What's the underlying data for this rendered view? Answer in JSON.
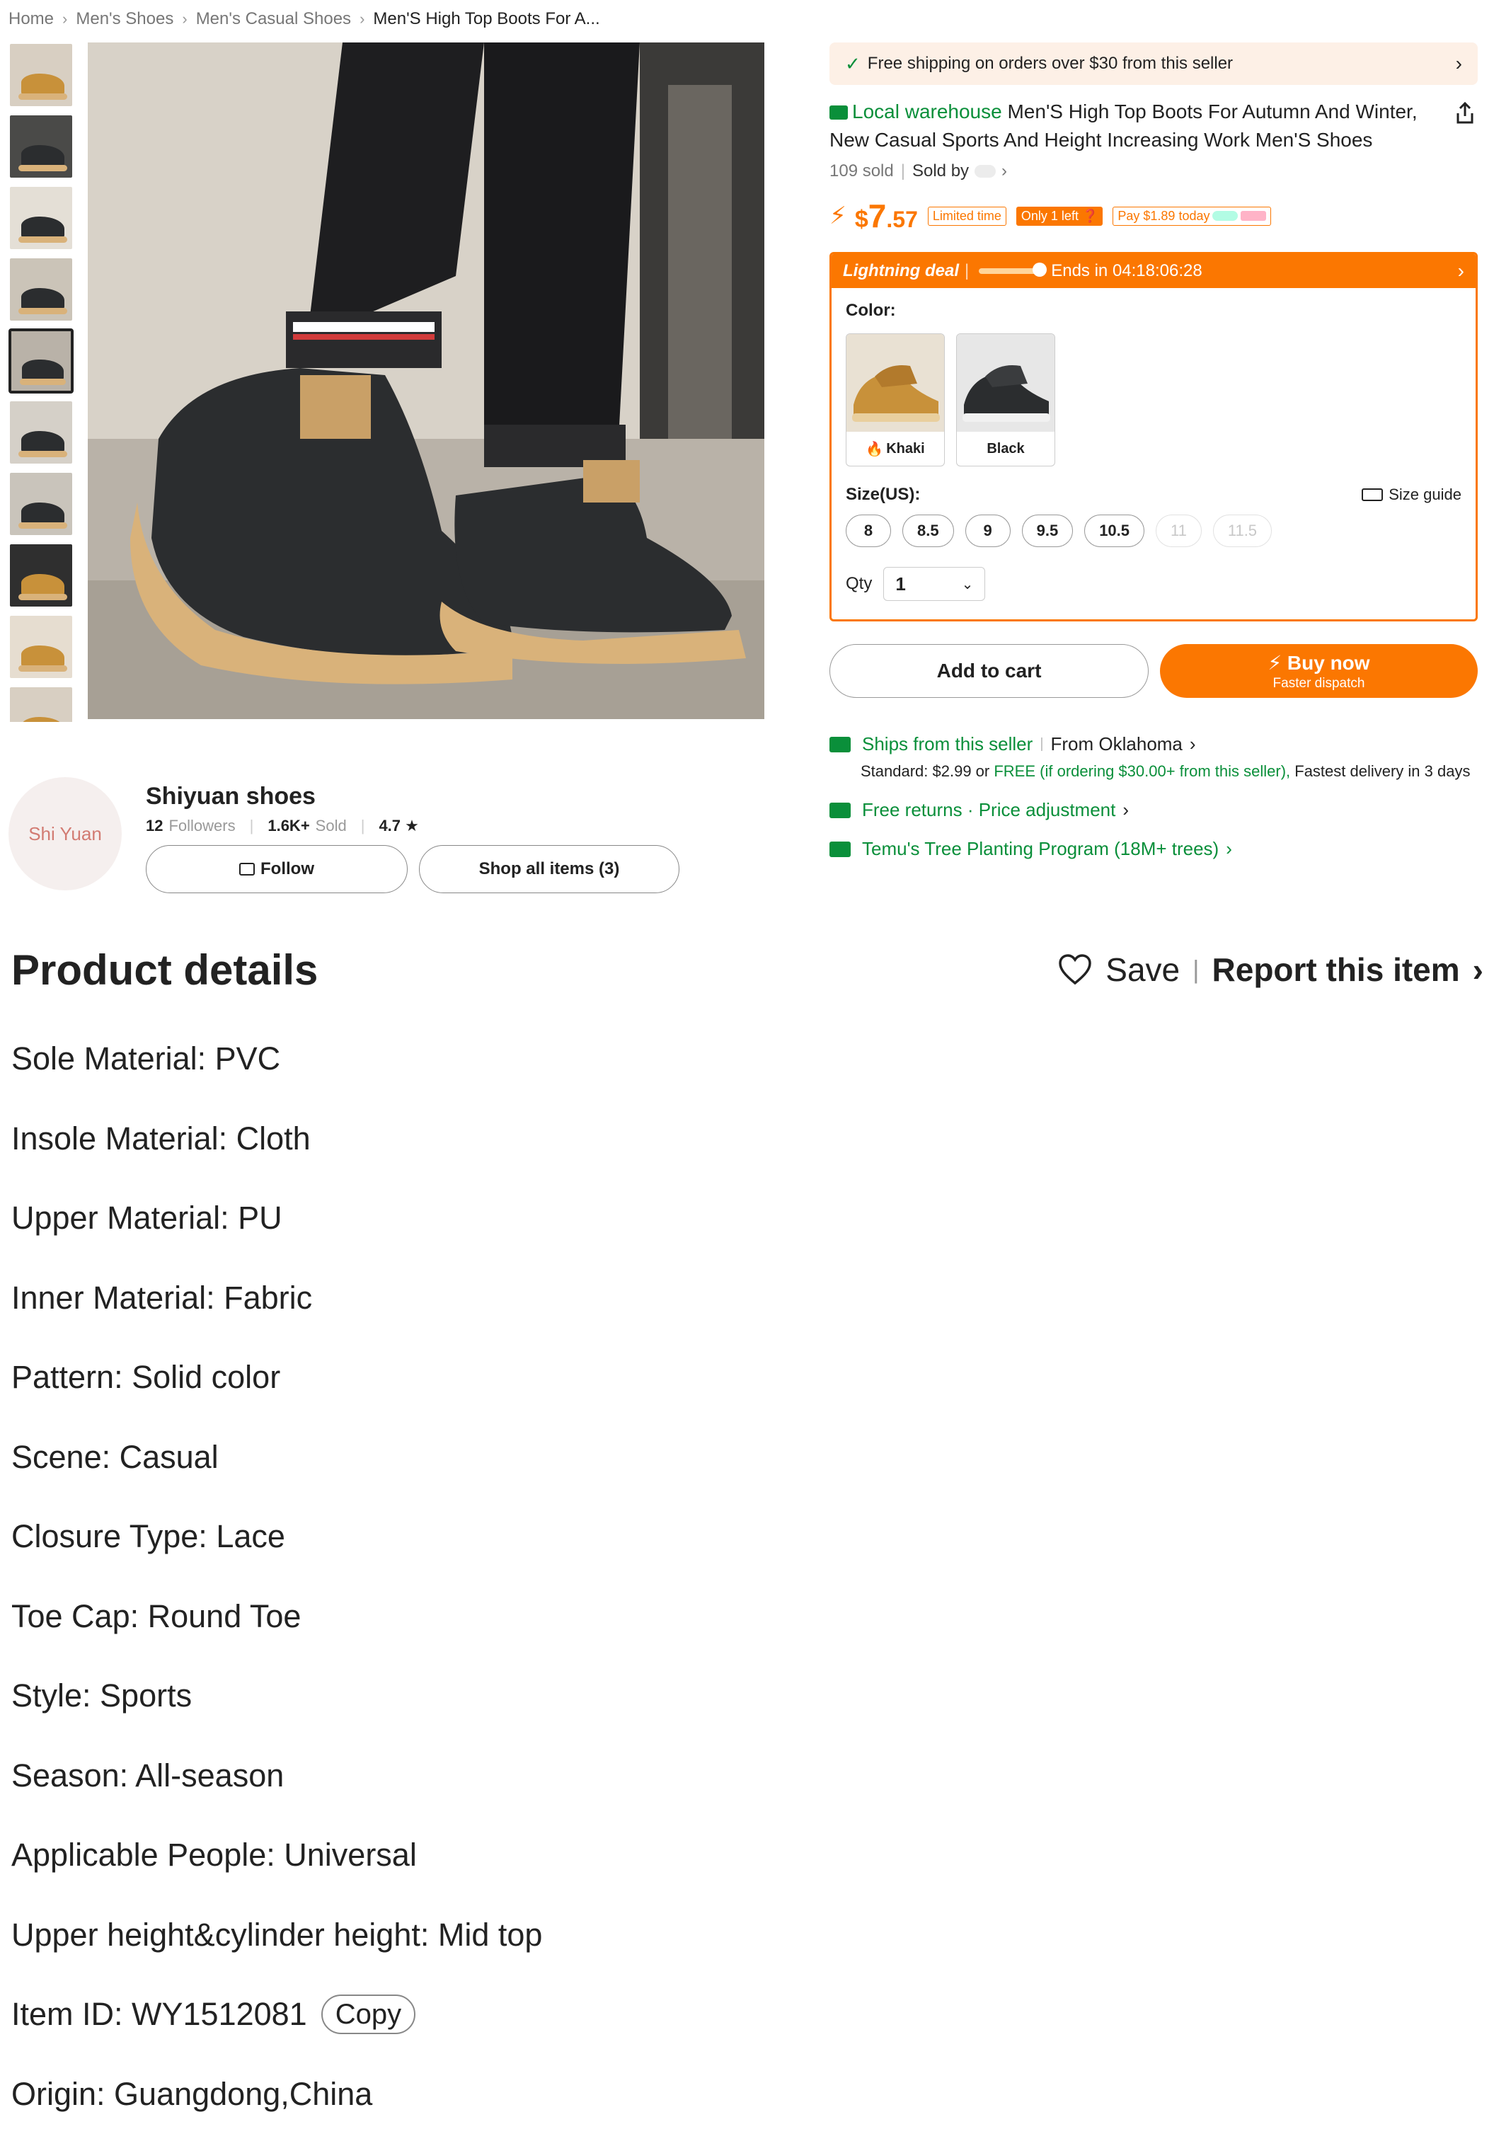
{
  "breadcrumb": [
    "Home",
    "Men's Shoes",
    "Men's Casual Shoes",
    "Men'S High Top Boots For A..."
  ],
  "gallery": {
    "thumbnails": 10,
    "active_index": 4
  },
  "shipping_banner": "Free shipping on orders over $30 from this seller",
  "product": {
    "badge": "Local warehouse",
    "title": "Men'S High Top Boots For Autumn And Winter, New Casual Sports And Height Increasing Work Men'S Shoes",
    "sold": "109 sold",
    "sold_by": "Sold by",
    "price_currency": "$",
    "price_int": "7",
    "price_dec": ".57",
    "tag_limited": "Limited time",
    "tag_left": "Only 1 left",
    "tag_pay": "Pay $1.89 today"
  },
  "deal": {
    "label": "Lightning deal",
    "ends": "Ends in 04:18:06:28"
  },
  "options": {
    "color_label": "Color:",
    "colors": [
      {
        "name": "Khaki",
        "hot": true
      },
      {
        "name": "Black",
        "hot": false
      }
    ],
    "size_label": "Size(US):",
    "size_guide": "Size guide",
    "sizes": [
      {
        "v": "8",
        "available": true
      },
      {
        "v": "8.5",
        "available": true
      },
      {
        "v": "9",
        "available": true
      },
      {
        "v": "9.5",
        "available": true
      },
      {
        "v": "10.5",
        "available": true
      },
      {
        "v": "11",
        "available": false
      },
      {
        "v": "11.5",
        "available": false
      }
    ],
    "qty_label": "Qty",
    "qty_value": "1"
  },
  "actions": {
    "add_to_cart": "Add to cart",
    "buy_now": "Buy now",
    "buy_now_sub": "Faster dispatch"
  },
  "shipping": {
    "ships_from": "Ships from this seller",
    "origin": "From Oklahoma",
    "standard_pre": "Standard: $2.99 or ",
    "standard_free": "FREE (if ordering $30.00+ from this seller),",
    "standard_post": " Fastest delivery in 3 days",
    "returns": "Free returns · Price adjustment",
    "tree": "Temu's Tree Planting Program (18M+ trees)"
  },
  "seller": {
    "avatar": "Shi Yuan",
    "name": "Shiyuan shoes",
    "followers_num": "12",
    "followers_label": "Followers",
    "sold_num": "1.6K+",
    "sold_label": "Sold",
    "rating": "4.7 ★",
    "follow": "Follow",
    "shop_all": "Shop all items (3)"
  },
  "details": {
    "title": "Product details",
    "save": "Save",
    "report": "Report this item",
    "copy": "Copy",
    "attributes": [
      "Sole Material: PVC",
      "Insole Material: Cloth",
      "Upper Material: PU",
      "Inner Material: Fabric",
      "Pattern: Solid color",
      "Scene: Casual",
      "Closure Type: Lace",
      "Toe Cap: Round Toe",
      "Style: Sports",
      "Season: All-season",
      "Applicable People: Universal",
      "Upper height&cylinder height: Mid top",
      "Item ID: WY1512081",
      "Origin: Guangdong,China"
    ]
  },
  "colors": {
    "accent": "#fb7701",
    "green": "#0a8f3a",
    "banner": "#fdf0e6"
  }
}
